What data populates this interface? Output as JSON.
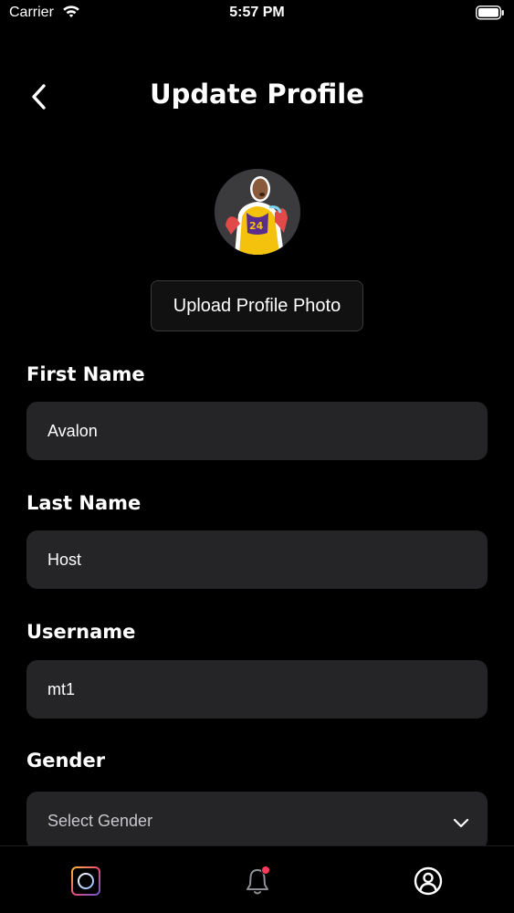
{
  "status_bar": {
    "carrier": "Carrier",
    "time": "5:57 PM",
    "icons": [
      "wifi-icon",
      "battery-icon"
    ]
  },
  "header": {
    "title": "Update Profile",
    "back_icon": "chevron-left-icon"
  },
  "profile": {
    "avatar_icon": "avatar",
    "upload_label": "Upload Profile Photo"
  },
  "fields": {
    "first_name": {
      "label": "First Name",
      "value": "Avalon"
    },
    "last_name": {
      "label": "Last Name",
      "value": "Host"
    },
    "username": {
      "label": "Username",
      "value": "mt1"
    },
    "gender": {
      "label": "Gender",
      "placeholder": "Select Gender"
    }
  },
  "tab_bar": {
    "tabs": [
      {
        "name": "home",
        "icon": "camera-frame-icon"
      },
      {
        "name": "notifications",
        "icon": "bell-icon",
        "has_badge": true
      },
      {
        "name": "profile",
        "icon": "user-circle-icon"
      }
    ]
  },
  "colors": {
    "background": "#000000",
    "field_background": "#252528",
    "badge": "#ff3b5c"
  }
}
